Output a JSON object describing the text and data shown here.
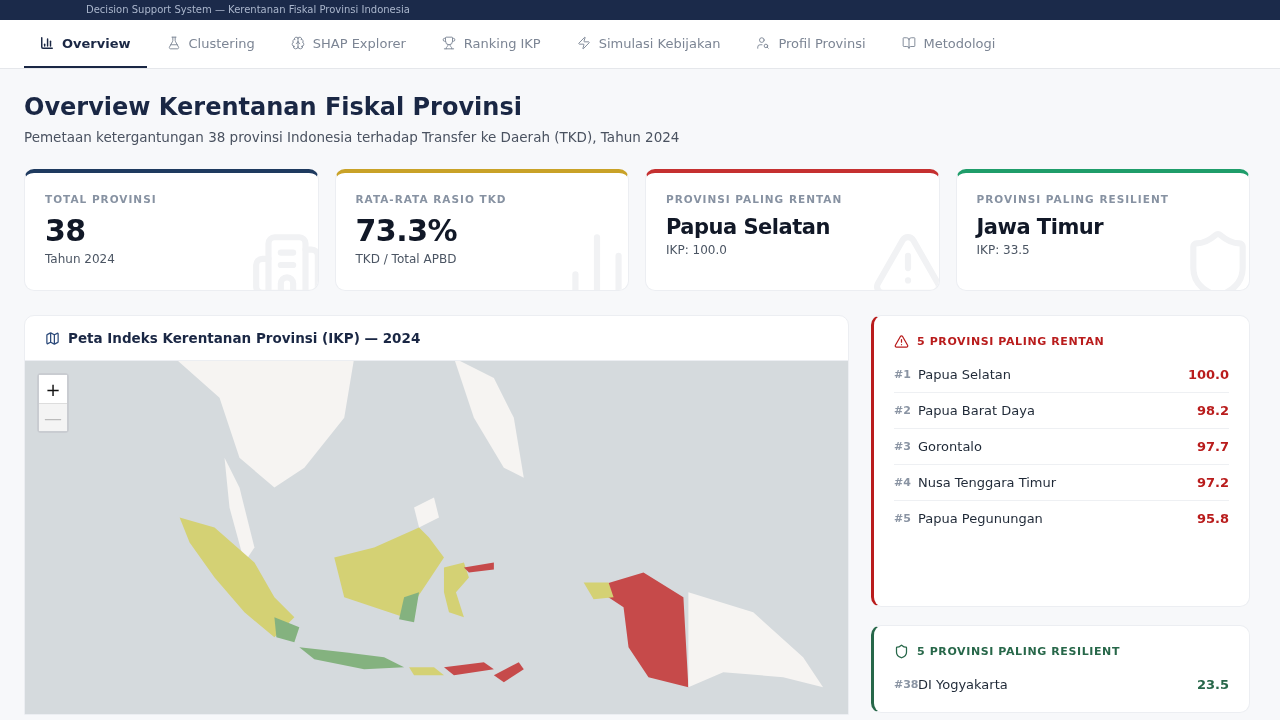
{
  "header": {
    "subtitle": "Decision Support System — Kerentanan Fiskal Provinsi Indonesia"
  },
  "tabs": [
    {
      "label": "Overview",
      "selected": true
    },
    {
      "label": "Clustering",
      "selected": false
    },
    {
      "label": "SHAP Explorer",
      "selected": false
    },
    {
      "label": "Ranking IKP",
      "selected": false
    },
    {
      "label": "Simulasi Kebijakan",
      "selected": false
    },
    {
      "label": "Profil Provinsi",
      "selected": false
    },
    {
      "label": "Metodologi",
      "selected": false
    }
  ],
  "page": {
    "title": "Overview Kerentanan Fiskal Provinsi",
    "subtitle": "Pemetaan ketergantungan 38 provinsi Indonesia terhadap Transfer ke Daerah (TKD), Tahun 2024"
  },
  "stats": [
    {
      "label": "TOTAL PROVINSI",
      "value": "38",
      "note": "Tahun 2024",
      "kind": "number",
      "color": "#1e3a5f"
    },
    {
      "label": "RATA-RATA RASIO TKD",
      "value": "73.3%",
      "note": "TKD / Total APBD",
      "kind": "number",
      "color": "#c9a227"
    },
    {
      "label": "PROVINSI PALING RENTAN",
      "value": "Papua Selatan",
      "note": "IKP: 100.0",
      "kind": "name",
      "color": "#c53030"
    },
    {
      "label": "PROVINSI PALING RESILIENT",
      "value": "Jawa Timur",
      "note": "IKP: 33.5",
      "kind": "name",
      "color": "#1f9d6a"
    }
  ],
  "map": {
    "title": "Peta Indeks Kerentanan Provinsi (IKP) — 2024",
    "zoom_in": "+",
    "zoom_out": "—",
    "kind": "picture"
  },
  "lists": [
    {
      "title": "5 PROVINSI PALING RENTAN",
      "color": "#b91c1c",
      "items": [
        {
          "rank": "#1",
          "name": "Papua Selatan",
          "score": "100.0"
        },
        {
          "rank": "#2",
          "name": "Papua Barat Daya",
          "score": "98.2"
        },
        {
          "rank": "#3",
          "name": "Gorontalo",
          "score": "97.7"
        },
        {
          "rank": "#4",
          "name": "Nusa Tenggara Timur",
          "score": "97.2"
        },
        {
          "rank": "#5",
          "name": "Papua Pegunungan",
          "score": "95.8"
        }
      ]
    },
    {
      "title": "5 PROVINSI PALING RESILIENT",
      "color": "#276749",
      "items": [
        {
          "rank": "#38",
          "name": "DI Yogyakarta",
          "score": "23.5"
        }
      ]
    }
  ]
}
